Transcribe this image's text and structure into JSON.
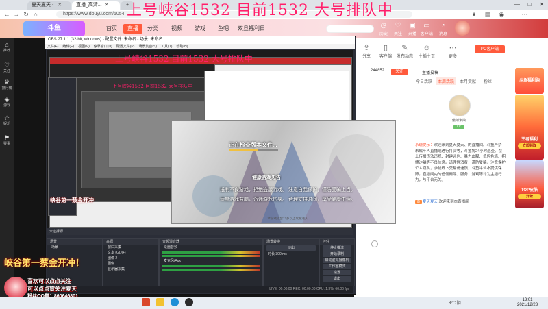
{
  "overlay_title": "上号峡谷1532 目前1532 大号排队中",
  "browser": {
    "tabs": [
      {
        "title": "夏天夏天 - "
      },
      {
        "title": "直播_高清...",
        "active": true
      },
      {
        "title": ""
      }
    ],
    "url": "https://www.douyu.com/6054",
    "window_controls": [
      "—",
      "□",
      "✕"
    ]
  },
  "site": {
    "logo": "斗鱼",
    "nav": [
      {
        "label": "首页"
      },
      {
        "label": "直播",
        "active": true
      },
      {
        "label": "分类"
      },
      {
        "label": "视频"
      },
      {
        "label": "游戏"
      },
      {
        "label": "鱼吧"
      },
      {
        "label": "双旦福利日"
      }
    ],
    "search_placeholder": "",
    "header_icons": [
      {
        "label": "历史"
      },
      {
        "label": "关注"
      },
      {
        "label": "开播"
      },
      {
        "label": "客户端"
      },
      {
        "label": "消息"
      }
    ]
  },
  "left_sidebar": [
    {
      "label": "推荐"
    },
    {
      "label": "关注"
    },
    {
      "label": "排行榜"
    },
    {
      "label": "游戏"
    },
    {
      "label": "娱乐"
    },
    {
      "label": "赛事"
    }
  ],
  "room_toolbar": {
    "icons": [
      {
        "label": "分享"
      },
      {
        "label": "客户端"
      },
      {
        "label": "发布动态"
      },
      {
        "label": "主播主页"
      },
      {
        "label": "更多"
      }
    ],
    "pc_download": "PC客户端",
    "fans_count": "244852",
    "follow": "关注"
  },
  "chat": {
    "rank_title": "主播投稿",
    "tabs": [
      {
        "label": "今日活跃"
      },
      {
        "label": "本周活跃",
        "active": true
      },
      {
        "label": "本月贡献"
      },
      {
        "label": "粉丝"
      }
    ],
    "top_user": {
      "name": "傲娇米娘",
      "badge": "LV"
    },
    "system_message": {
      "tag": "系统提示：",
      "text": "欢迎来到夏天夏天、的直播间。斗鱼严禁未成年人直播或进行打赏等，斗鱼将24小时巡查。禁止传播违法违规、封建迷信、暴力血腥、低俗色情、招嫖诈骗等不良信息。请理性消费，谨防受骗，注意保护个人隐私，涉及线下交易请谨慎，斗鱼平台不提供保障。直播间内的任何商品、服务、游戏等均为主播行为，与平台无关。"
    },
    "welcome": {
      "badge": "贵",
      "user": "夏天夏天",
      "text": "欢迎来到本直播间"
    }
  },
  "ads": [
    {
      "title": "斗鱼福利购"
    },
    {
      "title": "王者福利",
      "button": "立即领取"
    },
    {
      "title": "TOP皮肤",
      "button": "开抢"
    }
  ],
  "obs": {
    "title": "OBS 27.1.1 (32-bit, windows) - 配置文件: 未命名 - 场景: 未命名",
    "menu": [
      "文件(F)",
      "编辑(E)",
      "视图(V)",
      "停靠窗口(D)",
      "配置文件(P)",
      "场景集合(S)",
      "工具(T)",
      "帮助(H)"
    ],
    "preview_title": "上号峡谷1532 目前1532 大号排队中",
    "toolbar_label": "未选择源",
    "docks": {
      "scenes": {
        "title": "场景",
        "items": [
          "场景"
        ]
      },
      "sources": {
        "title": "来源",
        "items": [
          "窗口采集",
          "文本 (GDI+)",
          "图像 2",
          "图像",
          "显示器采集"
        ]
      },
      "mixer": {
        "title": "音频混音器",
        "channels": [
          "桌面音频",
          "麦克风/Aux"
        ]
      },
      "transitions": {
        "title": "场景转换",
        "type": "淡出",
        "duration_label": "时长",
        "duration": "300 ms"
      },
      "controls": {
        "title": "控件",
        "buttons": [
          "停止推流",
          "开始录制",
          "启动虚拟摄像机",
          "工作室模式",
          "设置",
          "退出"
        ]
      }
    },
    "status": "LIVE: 00:00:00   REC: 00:00:00   CPU: 1.3%, 60.00 fps"
  },
  "game_dialog": {
    "status": "正在检查版本文件...",
    "progress": 0.6,
    "health_title": "健康游戏忠告",
    "health_lines": [
      "抵制不良游戏，拒绝盗版游戏。",
      "注意自我保护，谨防受骗上当。",
      "适度游戏益脑，沉迷游戏伤身。",
      "合理安排时间，享受健康生活。"
    ],
    "footer": "本游戏适合12岁以上玩家进入"
  },
  "streamer_overlay": {
    "promo": "峡谷第一蔡金开冲！",
    "lines": [
      "喜欢可以点点关注",
      "可以点点赞关注夏天",
      "粉丝QQ群：860646801"
    ],
    "small_promo": "峡谷第一蔡金开冲"
  },
  "taskbar": {
    "weather": "8°C 阴",
    "time": "13:01",
    "date": "2021/12/23"
  }
}
